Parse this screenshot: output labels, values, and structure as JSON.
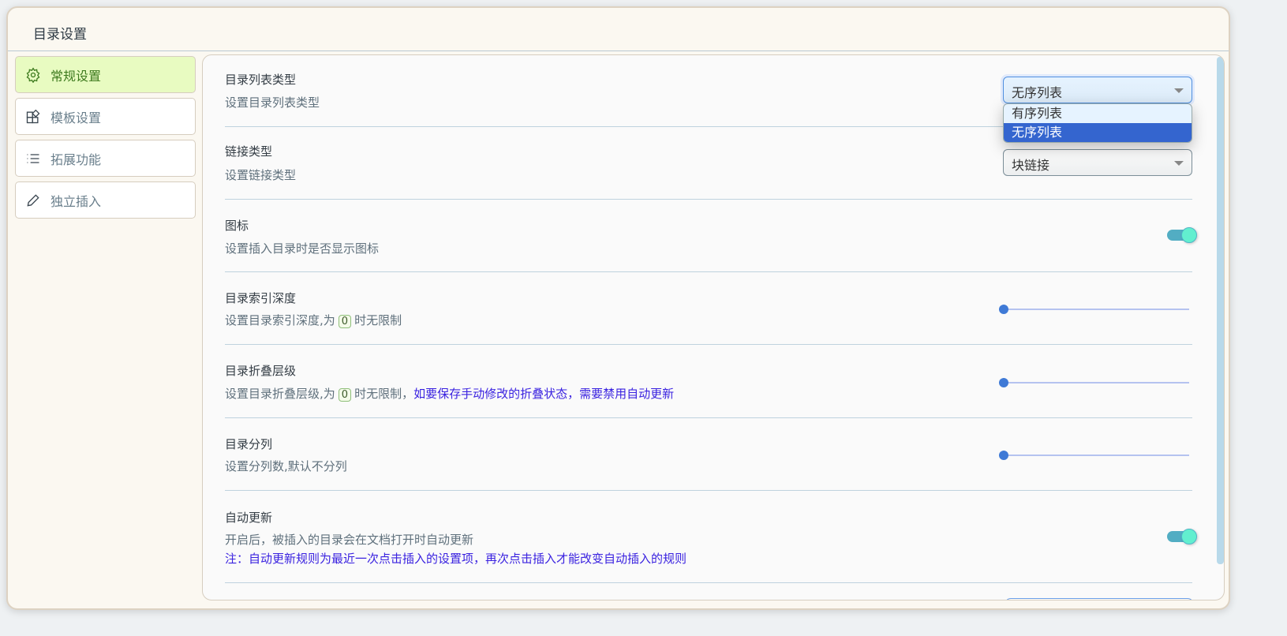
{
  "dialog": {
    "title": "目录设置"
  },
  "sidebar": {
    "items": [
      {
        "label": "常规设置",
        "icon": "gear-icon",
        "active": true
      },
      {
        "label": "模板设置",
        "icon": "template-icon"
      },
      {
        "label": "拓展功能",
        "icon": "list-icon"
      },
      {
        "label": "独立插入",
        "icon": "pencil-icon"
      }
    ]
  },
  "settings": {
    "list_type": {
      "title": "目录列表类型",
      "desc": "设置目录列表类型",
      "value": "无序列表",
      "options": [
        "有序列表",
        "无序列表"
      ]
    },
    "link_type": {
      "title": "链接类型",
      "desc": "设置链接类型",
      "value": "块链接"
    },
    "icon": {
      "title": "图标",
      "desc": "设置插入目录时是否显示图标",
      "enabled": true
    },
    "depth": {
      "title": "目录索引深度",
      "desc_a": "设置目录索引深度,为",
      "zero": "0",
      "desc_b": "时无限制",
      "value": 0
    },
    "fold": {
      "title": "目录折叠层级",
      "desc_a": "设置目录折叠层级,为",
      "zero": "0",
      "desc_b": "时无限制，",
      "note": "如要保存手动修改的折叠状态，需要禁用自动更新",
      "value": 0
    },
    "columns": {
      "title": "目录分列",
      "desc": "设置分列数,默认不分列",
      "value": 0
    },
    "auto_update": {
      "title": "自动更新",
      "desc": "开启后，被插入的目录会在文档打开时自动更新",
      "note": "注：自动更新规则为最近一次点击插入的设置项，再次点击插入才能改变自动插入的规则",
      "enabled": true
    }
  },
  "colors": {
    "active_bg": "#e8fbc1",
    "accent": "#3465cf",
    "toggle": "#62efcf",
    "note": "#3a22e0"
  }
}
